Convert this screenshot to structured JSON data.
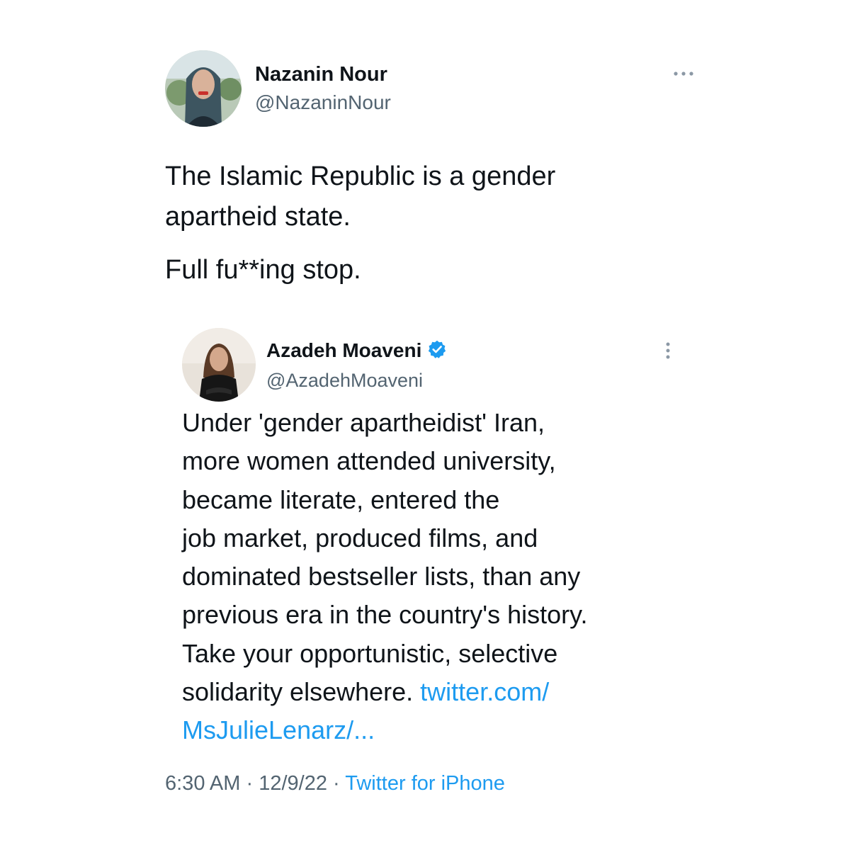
{
  "tweet": {
    "author_name": "Nazanin Nour",
    "author_handle": "@NazaninNour",
    "text_line_1": "The Islamic Republic is a gender",
    "text_line_2": "apartheid state.",
    "text_line_3": "Full fu**ing stop.",
    "more_icon": "more-horizontal-icon"
  },
  "quoted_tweet": {
    "author_name": "Azadeh Moaveni",
    "author_handle": "@AzadehMoaveni",
    "verified_icon": "verified-badge-icon",
    "more_icon": "more-vertical-icon",
    "lines": [
      "Under 'gender apartheidist' Iran,",
      "more women attended university,",
      "became literate, entered the",
      "job market, produced films, and",
      "dominated bestseller lists, than any",
      "previous era in the country's history.",
      "Take your opportunistic, selective"
    ],
    "line_8_text": "solidarity elsewhere.",
    "link_part_1": "twitter.com/",
    "link_part_2": "MsJulieLenarz/..."
  },
  "meta": {
    "time": "6:30 AM",
    "separator": "·",
    "date": "12/9/22",
    "source": "Twitter for iPhone"
  },
  "colors": {
    "link": "#1d9bf0",
    "secondary_text": "#536471",
    "primary_text": "#0f1419"
  }
}
